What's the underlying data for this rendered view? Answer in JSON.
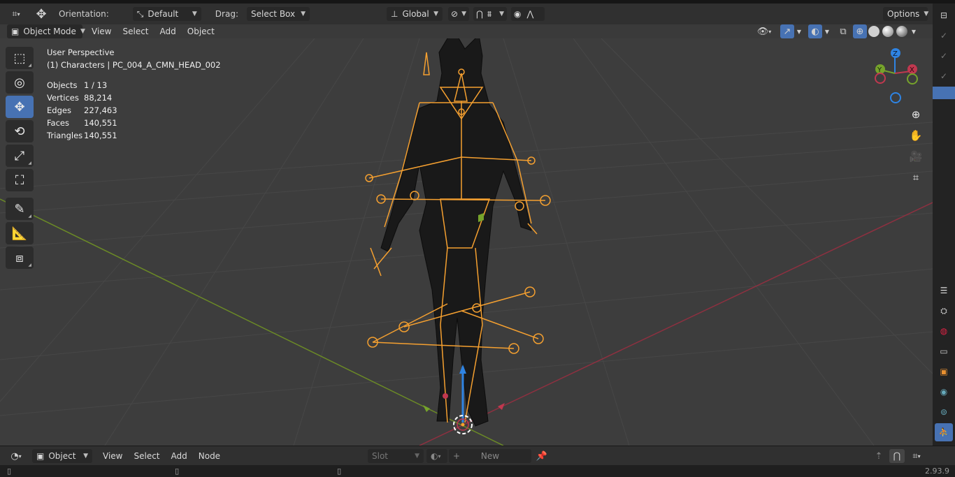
{
  "header": {
    "orientation_label": "Orientation:",
    "orientation_value": "Default",
    "drag_label": "Drag:",
    "drag_value": "Select Box",
    "transform_space": "Global",
    "options_label": "Options"
  },
  "viewport_header": {
    "mode": "Object Mode",
    "menus": [
      "View",
      "Select",
      "Add",
      "Object"
    ]
  },
  "overlay": {
    "view_name": "User Perspective",
    "collection_object": "(1) Characters | PC_004_A_CMN_HEAD_002",
    "stats": [
      {
        "key": "Objects",
        "value": "1 / 13"
      },
      {
        "key": "Vertices",
        "value": "88,214"
      },
      {
        "key": "Edges",
        "value": "227,463"
      },
      {
        "key": "Faces",
        "value": "140,551"
      },
      {
        "key": "Triangles",
        "value": "140,551"
      }
    ]
  },
  "gizmo": {
    "axis_labels": [
      "Z",
      "Y",
      "X"
    ]
  },
  "bottom": {
    "editor_type": "Object",
    "menus": [
      "View",
      "Select",
      "Add",
      "Node"
    ],
    "slot_label": "Slot",
    "new_label": "New"
  },
  "status": {
    "version": "2.93.9"
  },
  "colors": {
    "accent": "#4772b3",
    "armature": "#f5a030",
    "x_axis": "#c0384f",
    "y_axis": "#76a32b",
    "z_axis": "#2f84e3"
  },
  "icons": {
    "toolbar": [
      "select-box-icon",
      "cursor-icon",
      "move-icon",
      "rotate-icon",
      "scale-icon",
      "transform-icon",
      "annotate-icon",
      "measure-icon",
      "add-cube-icon"
    ],
    "nav": [
      "zoom-icon",
      "pan-hand-icon",
      "camera-icon",
      "grid-icon"
    ]
  }
}
